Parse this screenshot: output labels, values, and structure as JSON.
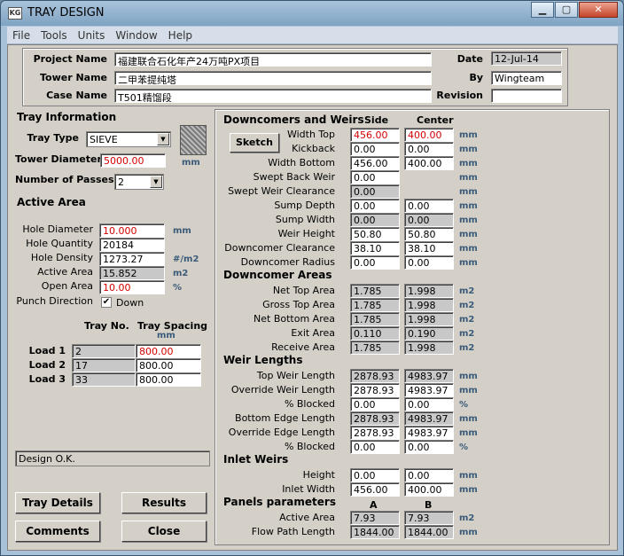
{
  "window": {
    "title": "TRAY DESIGN",
    "icon_text": "KG"
  },
  "menu": [
    "File",
    "Tools",
    "Units",
    "Window",
    "Help"
  ],
  "header": {
    "project_name_label": "Project Name",
    "project_name": "福建联合石化年产24万吨PX项目",
    "tower_name_label": "Tower Name",
    "tower_name": "二甲苯提纯塔",
    "case_name_label": "Case Name",
    "case_name": "T501精馏段",
    "date_label": "Date",
    "date": "12-Jul-14",
    "by_label": "By",
    "by": "Wingteam",
    "revision_label": "Revision",
    "revision": ""
  },
  "tray_info": {
    "title": "Tray Information",
    "tray_type_label": "Tray Type",
    "tray_type": "SIEVE",
    "tower_diameter_label": "Tower Diameter",
    "tower_diameter": "5000.00",
    "tower_diameter_unit": "mm",
    "passes_label": "Number of Passes",
    "passes": "2"
  },
  "active_area": {
    "title": "Active Area",
    "hole_diameter_label": "Hole Diameter",
    "hole_diameter": "10.000",
    "hole_diameter_unit": "mm",
    "hole_quantity_label": "Hole Quantity",
    "hole_quantity": "20184",
    "hole_density_label": "Hole Density",
    "hole_density": "1273.27",
    "hole_density_unit": "#/m2",
    "active_area_label": "Active Area",
    "active_area": "15.852",
    "active_area_unit": "m2",
    "open_area_label": "Open Area",
    "open_area": "10.00",
    "open_area_unit": "%",
    "punch_label": "Punch Direction",
    "punch_value": "Down",
    "punch_checked": "✔"
  },
  "loads": {
    "tray_no_header": "Tray No.",
    "spacing_header": "Tray Spacing",
    "spacing_unit": "mm",
    "rows": [
      {
        "label": "Load 1",
        "tray": "2",
        "spacing": "800.00"
      },
      {
        "label": "Load 2",
        "tray": "17",
        "spacing": "800.00"
      },
      {
        "label": "Load 3",
        "tray": "33",
        "spacing": "800.00"
      }
    ]
  },
  "status": "Design O.K.",
  "buttons": {
    "tray_details": "Tray Details",
    "results": "Results",
    "comments": "Comments",
    "close": "Close",
    "sketch": "Sketch"
  },
  "downcomers": {
    "title": "Downcomers and Weirs",
    "side_header": "Side",
    "center_header": "Center",
    "rows": [
      {
        "label": "Width Top",
        "side": "456.00",
        "center": "400.00",
        "unit": "mm"
      },
      {
        "label": "Kickback",
        "side": "0.00",
        "center": "0.00",
        "unit": "mm"
      },
      {
        "label": "Width Bottom",
        "side": "456.00",
        "center": "400.00",
        "unit": "mm"
      },
      {
        "label": "Swept Back Weir",
        "side": "0.00",
        "center": "",
        "unit": "mm"
      },
      {
        "label": "Swept Weir Clearance",
        "side": "0.00",
        "center": "",
        "unit": "mm"
      },
      {
        "label": "Sump Depth",
        "side": "0.00",
        "center": "0.00",
        "unit": "mm"
      },
      {
        "label": "Sump Width",
        "side": "0.00",
        "center": "0.00",
        "unit": "mm"
      },
      {
        "label": "Weir Height",
        "side": "50.80",
        "center": "50.80",
        "unit": "mm"
      },
      {
        "label": "Downcomer Clearance",
        "side": "38.10",
        "center": "38.10",
        "unit": "mm"
      },
      {
        "label": "Downcomer Radius",
        "side": "0.00",
        "center": "0.00",
        "unit": "mm"
      }
    ]
  },
  "dc_areas": {
    "title": "Downcomer Areas",
    "rows": [
      {
        "label": "Net Top Area",
        "side": "1.785",
        "center": "1.998",
        "unit": "m2"
      },
      {
        "label": "Gross Top Area",
        "side": "1.785",
        "center": "1.998",
        "unit": "m2"
      },
      {
        "label": "Net Bottom Area",
        "side": "1.785",
        "center": "1.998",
        "unit": "m2"
      },
      {
        "label": "Exit Area",
        "side": "0.110",
        "center": "0.190",
        "unit": "m2"
      },
      {
        "label": "Receive Area",
        "side": "1.785",
        "center": "1.998",
        "unit": "m2"
      }
    ]
  },
  "weir_lengths": {
    "title": "Weir Lengths",
    "rows": [
      {
        "label": "Top Weir Length",
        "side": "2878.93",
        "center": "4983.97",
        "unit": "mm"
      },
      {
        "label": "Override Weir Length",
        "side": "2878.93",
        "center": "4983.97",
        "unit": "mm"
      },
      {
        "label": "% Blocked",
        "side": "0.00",
        "center": "0.00",
        "unit": "%"
      },
      {
        "label": "Bottom Edge Length",
        "side": "2878.93",
        "center": "4983.97",
        "unit": "mm"
      },
      {
        "label": "Override Edge Length",
        "side": "2878.93",
        "center": "4983.97",
        "unit": "mm"
      },
      {
        "label": "% Blocked",
        "side": "0.00",
        "center": "0.00",
        "unit": "%"
      }
    ]
  },
  "inlet_weirs": {
    "title": "Inlet Weirs",
    "rows": [
      {
        "label": "Height",
        "side": "0.00",
        "center": "0.00",
        "unit": "mm"
      },
      {
        "label": "Inlet Width",
        "side": "456.00",
        "center": "400.00",
        "unit": "mm"
      }
    ]
  },
  "panels": {
    "title": "Panels parameters",
    "a_header": "A",
    "b_header": "B",
    "rows": [
      {
        "label": "Active Area",
        "a": "7.93",
        "b": "7.93",
        "unit": "m2"
      },
      {
        "label": "Flow Path Length",
        "a": "1844.00",
        "b": "1844.00",
        "unit": "mm"
      }
    ]
  }
}
